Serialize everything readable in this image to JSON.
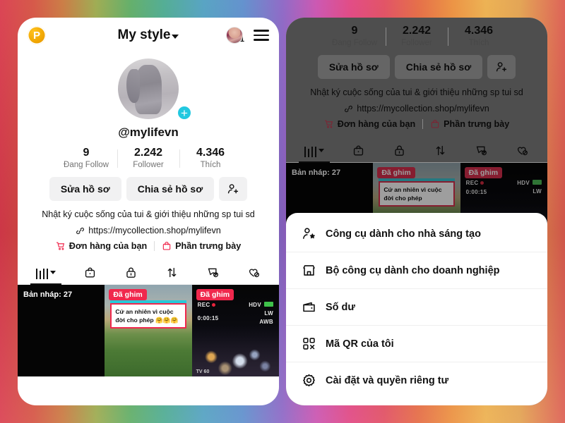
{
  "theme": {
    "accent_cyan": "#22c8e0",
    "pin_red": "#f0284d",
    "badge_orange": "#f0a500",
    "text_primary": "#111111",
    "text_muted": "#737373",
    "button_grey": "#f1f1f2"
  },
  "left_panel": {
    "header": {
      "badge_letter": "P",
      "title": "My style",
      "avatar_badge_count": "1",
      "chevron_icon": "chevron-down-icon",
      "menu_icon": "hamburger-menu-icon"
    },
    "profile": {
      "handle": "@mylifevn",
      "add_button": "+",
      "stats": [
        {
          "num": "9",
          "label": "Đang Follow"
        },
        {
          "num": "2.242",
          "label": "Follower"
        },
        {
          "num": "4.346",
          "label": "Thích"
        }
      ],
      "buttons": {
        "edit": "Sửa hồ sơ",
        "share": "Chia sẻ hồ sơ",
        "add_friend_icon": "add-person-icon"
      },
      "bio": "Nhật ký cuộc sống của tui & giới thiệu những sp tui sd",
      "link": "https://mycollection.shop/mylifevn",
      "shop_links": [
        {
          "label": "Đơn hàng của bạn",
          "icon": "shopping-cart-icon"
        },
        {
          "label": "Phần trưng bày",
          "icon": "shopping-bag-icon"
        }
      ]
    },
    "tabs": [
      {
        "name": "grid-tab",
        "icon": "grid-bars-icon",
        "active": true
      },
      {
        "name": "shop-tab",
        "icon": "shopping-bag-icon",
        "active": false
      },
      {
        "name": "private-tab",
        "icon": "lock-icon",
        "active": false
      },
      {
        "name": "repost-tab",
        "icon": "repost-arrows-icon",
        "active": false
      },
      {
        "name": "saved-tab",
        "icon": "bookmark-hidden-icon",
        "active": false
      },
      {
        "name": "liked-tab",
        "icon": "heart-hidden-icon",
        "active": false
      }
    ],
    "thumbnails": [
      {
        "label": "Bản nháp: 27",
        "pin": ""
      },
      {
        "pin": "Đã ghim",
        "caption": "Cứ an nhiên vì cuộc đời cho phép 🤗🤗🤗"
      },
      {
        "pin": "Đã ghim",
        "rec_label": "REC",
        "rec_time": "0:00:15",
        "hdv_label": "HDV",
        "lw_label": "LW",
        "awb_label": "AWB",
        "tv_label": "TV 60"
      }
    ]
  },
  "right_panel": {
    "stats": [
      {
        "num": "9",
        "label": "Đang Follow"
      },
      {
        "num": "2.242",
        "label": "Follower"
      },
      {
        "num": "4.346",
        "label": "Thích"
      }
    ],
    "buttons": {
      "edit": "Sửa hồ sơ",
      "share": "Chia sẻ hồ sơ",
      "add_friend_icon": "add-person-icon"
    },
    "bio": "Nhật ký cuộc sống của tui & giới thiệu những sp tui sd",
    "link": "https://mycollection.shop/mylifevn",
    "shop_links": [
      {
        "label": "Đơn hàng của bạn",
        "icon": "shopping-cart-icon"
      },
      {
        "label": "Phần trưng bày",
        "icon": "shopping-bag-icon"
      }
    ],
    "thumbnails": [
      {
        "label": "Bản nháp: 27"
      },
      {
        "pin": "Đã ghim",
        "caption": "Cứ an nhiên vì cuộc đời cho phép"
      },
      {
        "pin": "Đã ghim",
        "rec_label": "REC",
        "rec_time": "0:00:15",
        "hdv_label": "HDV",
        "lw_label": "LW"
      }
    ],
    "menu_sheet": {
      "items": [
        {
          "label": "Công cụ dành cho nhà sáng tạo",
          "icon": "person-star-icon"
        },
        {
          "label": "Bộ công cụ dành cho doanh nghiệp",
          "icon": "storefront-icon"
        },
        {
          "label": "Số dư",
          "icon": "wallet-icon"
        },
        {
          "label": "Mã QR của tôi",
          "icon": "qr-code-icon"
        },
        {
          "label": "Cài đặt và quyền riêng tư",
          "icon": "gear-icon"
        }
      ]
    }
  }
}
